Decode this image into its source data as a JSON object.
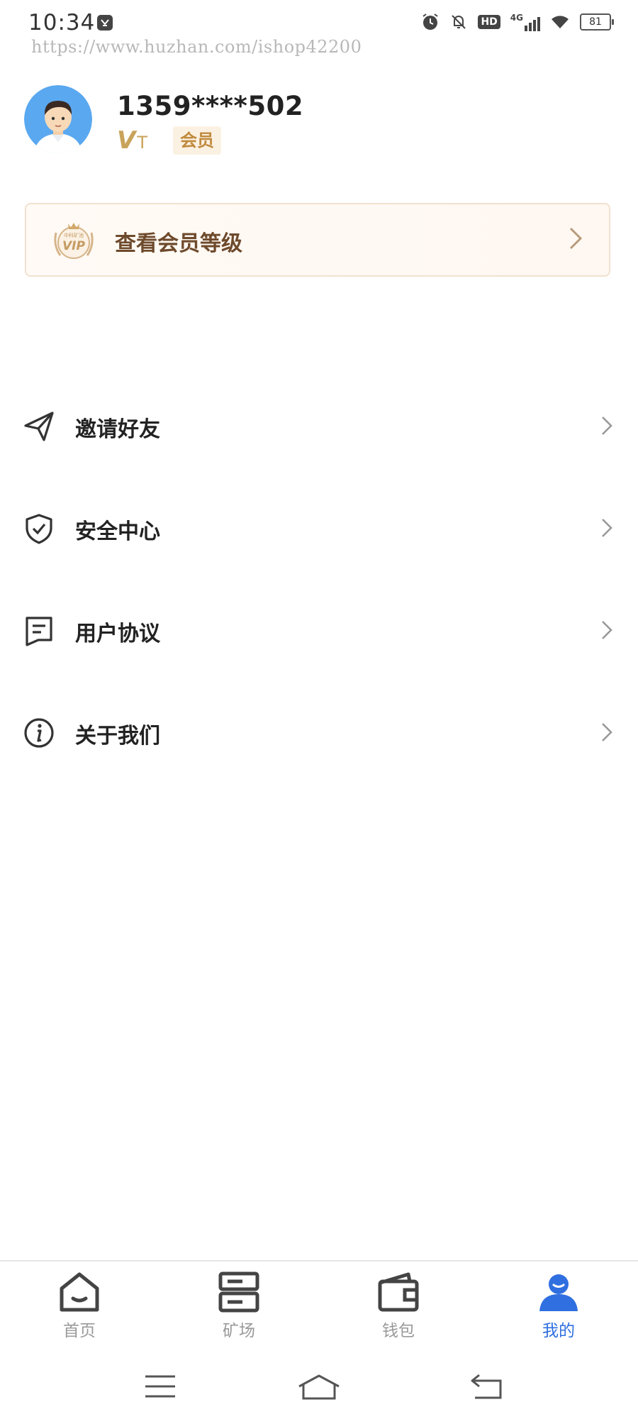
{
  "status_bar": {
    "time": "10:34",
    "watermark": "https://www.huzhan.com/ishop42200",
    "network": "4G",
    "hd": "HD",
    "battery": "81",
    "icons": [
      "alarm-icon",
      "bell-muted-icon",
      "hd-icon",
      "signal-icon",
      "wifi-icon",
      "battery-icon"
    ]
  },
  "profile": {
    "phone": "1359****502",
    "level_v": "V",
    "level_t": "T",
    "member_badge": "会员"
  },
  "vip_card": {
    "label": "查看会员等级",
    "emblem_text": "VIP",
    "emblem_caption": "中科矿池"
  },
  "menu": {
    "items": [
      {
        "label": "邀请好友",
        "icon": "paper-plane-icon"
      },
      {
        "label": "安全中心",
        "icon": "shield-check-icon"
      },
      {
        "label": "用户协议",
        "icon": "document-icon"
      },
      {
        "label": "关于我们",
        "icon": "info-icon"
      }
    ]
  },
  "tabbar": {
    "tabs": [
      {
        "label": "首页",
        "icon": "home-icon",
        "active": false
      },
      {
        "label": "矿场",
        "icon": "server-icon",
        "active": false
      },
      {
        "label": "钱包",
        "icon": "wallet-icon",
        "active": false
      },
      {
        "label": "我的",
        "icon": "user-icon",
        "active": true
      }
    ]
  },
  "colors": {
    "accent": "#2f6fe0",
    "gold": "#c9a35b",
    "vip_text": "#6e4a2c",
    "inactive": "#9a9a9a"
  }
}
